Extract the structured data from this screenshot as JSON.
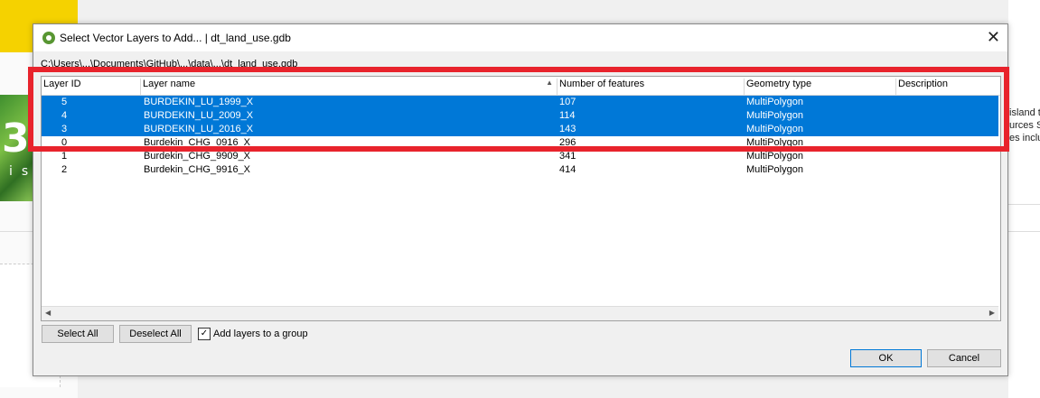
{
  "background": {
    "big_text": "3.",
    "small_text": "is",
    "right_text": [
      "island t",
      "urces S",
      "es incluc"
    ]
  },
  "dialog": {
    "title": "Select Vector Layers to Add... | dt_land_use.gdb",
    "close_glyph": "✕",
    "path": "C:\\Users\\...\\Documents\\GitHub\\...\\data\\...\\dt_land_use.gdb",
    "columns": [
      "Layer ID",
      "Layer name",
      "Number of features",
      "Geometry type",
      "Description"
    ],
    "sort_glyph": "▲",
    "rows": [
      {
        "id": "5",
        "name": "BURDEKIN_LU_1999_X",
        "features": "107",
        "geometry": "MultiPolygon",
        "description": "",
        "selected": true
      },
      {
        "id": "4",
        "name": "BURDEKIN_LU_2009_X",
        "features": "114",
        "geometry": "MultiPolygon",
        "description": "",
        "selected": true
      },
      {
        "id": "3",
        "name": "BURDEKIN_LU_2016_X",
        "features": "143",
        "geometry": "MultiPolygon",
        "description": "",
        "selected": true
      },
      {
        "id": "0",
        "name": "Burdekin_CHG_0916_X",
        "features": "296",
        "geometry": "MultiPolygon",
        "description": "",
        "selected": false
      },
      {
        "id": "1",
        "name": "Burdekin_CHG_9909_X",
        "features": "341",
        "geometry": "MultiPolygon",
        "description": "",
        "selected": false
      },
      {
        "id": "2",
        "name": "Burdekin_CHG_9916_X",
        "features": "414",
        "geometry": "MultiPolygon",
        "description": "",
        "selected": false
      }
    ],
    "scroll_left": "◀",
    "scroll_right": "▶",
    "select_all": "Select All",
    "deselect_all": "Deselect All",
    "add_to_group_label": "Add layers to a group",
    "add_to_group_checked": "✓",
    "ok": "OK",
    "cancel": "Cancel"
  },
  "colors": {
    "selection": "#0078d7",
    "highlight_box": "#e8232c",
    "qgis_green": "#589632"
  }
}
